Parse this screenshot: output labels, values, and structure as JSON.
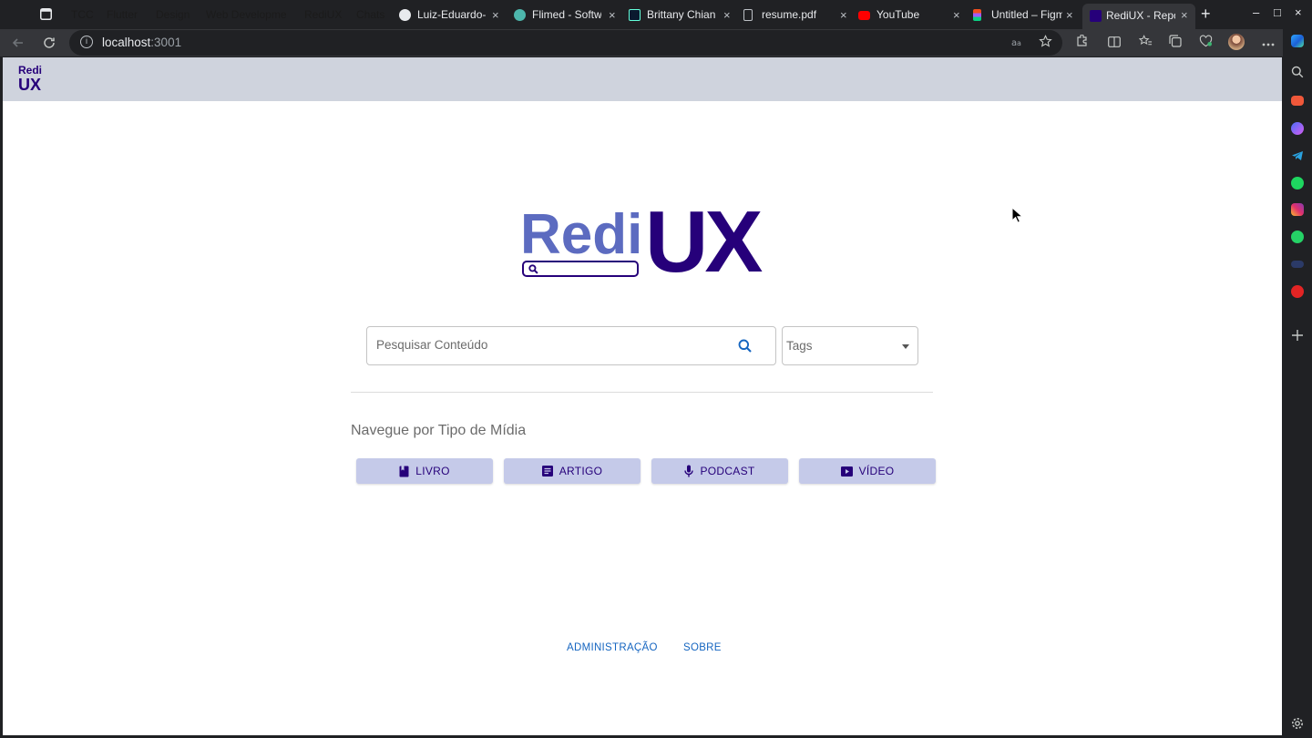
{
  "browser": {
    "tab_groups": [
      {
        "label": "TCC",
        "color": "#8ab4f8"
      },
      {
        "label": "Flutter",
        "color": "#ff63b8"
      },
      {
        "label": "Design",
        "color": "#fdd663"
      },
      {
        "label": "Web Developme",
        "color": "#ff8bcb"
      },
      {
        "label": "RediUX",
        "color": "#d7aefb"
      },
      {
        "label": "Chats",
        "color": "#78d9ec"
      }
    ],
    "tabs": [
      {
        "title": "Luiz-Eduardo-",
        "icon": "github-icon"
      },
      {
        "title": "Flimed - Softw",
        "icon": "globe-icon"
      },
      {
        "title": "Brittany Chian",
        "icon": "site-icon"
      },
      {
        "title": "resume.pdf",
        "icon": "file-icon"
      },
      {
        "title": "YouTube",
        "icon": "youtube-icon"
      },
      {
        "title": "Untitled – Figm",
        "icon": "figma-icon"
      },
      {
        "title": "RediUX - Repo",
        "icon": "rediux-icon",
        "active": true
      }
    ],
    "close_glyph": "×",
    "new_tab_glyph": "+",
    "window_controls": [
      "–",
      "□",
      "×"
    ],
    "address": {
      "host": "localhost",
      "port": ":3001"
    }
  },
  "app": {
    "mini_logo": {
      "top": "Redi",
      "bottom": "UX"
    },
    "hero_logo": {
      "left": "Redi",
      "right": "UX"
    },
    "search": {
      "placeholder": "Pesquisar Conteúdo"
    },
    "tags": {
      "label": "Tags"
    },
    "section_title": "Navegue por Tipo de Mídia",
    "media_buttons": [
      {
        "label": "LIVRO",
        "icon": "book-icon"
      },
      {
        "label": "ARTIGO",
        "icon": "article-icon"
      },
      {
        "label": "PODCAST",
        "icon": "mic-icon"
      },
      {
        "label": "VÍDEO",
        "icon": "video-icon"
      }
    ],
    "footer_links": [
      "ADMINISTRAÇÃO",
      "SOBRE"
    ]
  },
  "colors": {
    "brand_dark": "#26007a",
    "brand_light": "#5c6bc0",
    "button_bg": "#c5cae9",
    "appbar_bg": "#cfd3dd",
    "link": "#1565c0"
  }
}
